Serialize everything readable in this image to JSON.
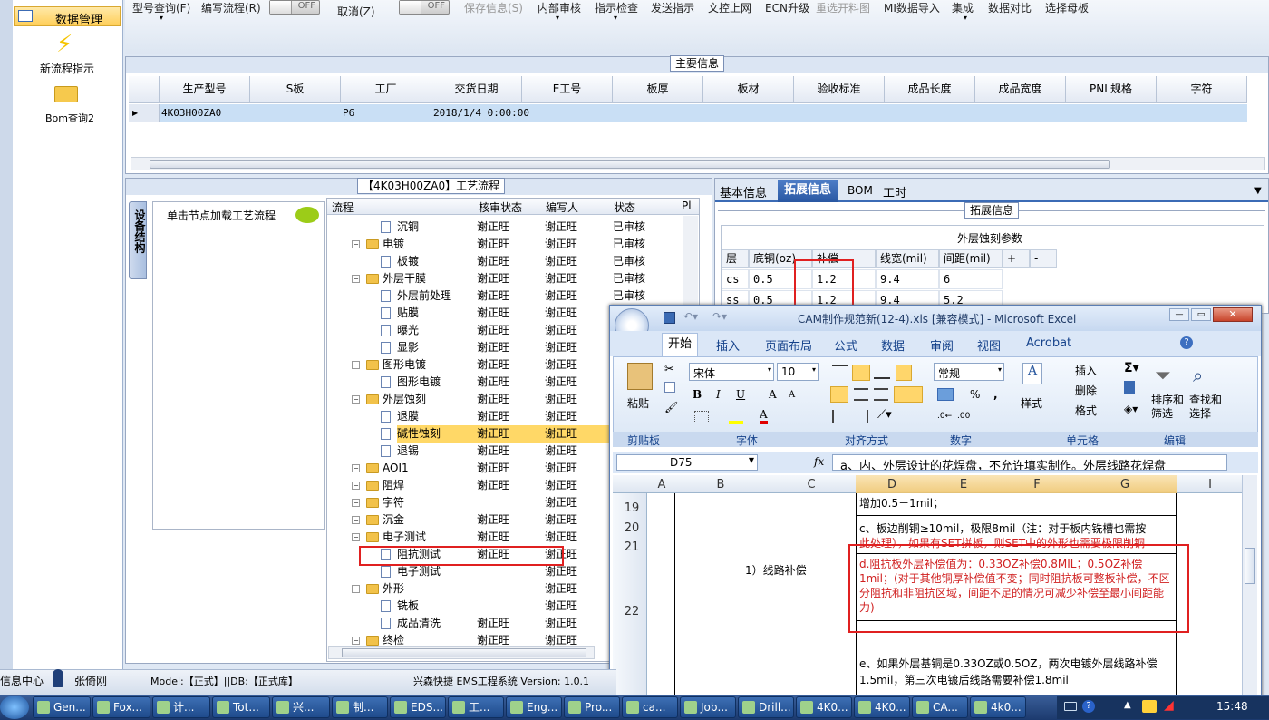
{
  "toolbar": {
    "items": [
      "型号查询(F)",
      "编写流程(R)",
      "取消(Z)",
      "保存信息(S)",
      "内部审核",
      "指示检查",
      "发送指示",
      "文控上网",
      "ECN升级",
      "重选开料图",
      "MI数据导入",
      "集成",
      "数据对比",
      "选择母板"
    ],
    "switch_off": "OFF"
  },
  "sidebar": {
    "header": "数据管理",
    "items": [
      {
        "label": "新流程指示",
        "icon": "lightning-icon"
      },
      {
        "label": "Bom查询2",
        "icon": "folder-open-icon"
      }
    ]
  },
  "main_info": {
    "title": "主要信息",
    "columns": [
      "生产型号",
      "S板",
      "工厂",
      "交货日期",
      "E工号",
      "板厚",
      "板材",
      "验收标准",
      "成品长度",
      "成品宽度",
      "PNL规格",
      "字符"
    ],
    "row": [
      "4K03H00ZA0",
      "",
      "P6",
      "2018/1/4 0:00:00",
      "",
      "",
      "",
      "",
      "",
      "",
      "",
      ""
    ]
  },
  "process": {
    "title": "【4K03H00ZA0】工艺流程",
    "side_tab": "设备结构",
    "hint": "单击节点加载工艺流程",
    "columns": [
      "流程",
      "核审状态",
      "编写人",
      "状态",
      "Pl"
    ],
    "rows": [
      {
        "name": "沉铜",
        "level": 2,
        "type": "doc",
        "review": "谢正旺",
        "writer": "谢正旺",
        "status": "已审核"
      },
      {
        "name": "电镀",
        "level": 1,
        "type": "folder",
        "review": "谢正旺",
        "writer": "谢正旺",
        "status": "已审核"
      },
      {
        "name": "板镀",
        "level": 2,
        "type": "doc",
        "review": "谢正旺",
        "writer": "谢正旺",
        "status": "已审核"
      },
      {
        "name": "外层干膜",
        "level": 1,
        "type": "folder",
        "review": "谢正旺",
        "writer": "谢正旺",
        "status": "已审核"
      },
      {
        "name": "外层前处理",
        "level": 2,
        "type": "doc",
        "review": "谢正旺",
        "writer": "谢正旺",
        "status": "已审核"
      },
      {
        "name": "贴膜",
        "level": 2,
        "type": "doc",
        "review": "谢正旺",
        "writer": "谢正旺",
        "status": "已审核"
      },
      {
        "name": "曝光",
        "level": 2,
        "type": "doc",
        "review": "谢正旺",
        "writer": "谢正旺",
        "status": "已审核"
      },
      {
        "name": "显影",
        "level": 2,
        "type": "doc",
        "review": "谢正旺",
        "writer": "谢正旺",
        "status": "已审核"
      },
      {
        "name": "图形电镀",
        "level": 1,
        "type": "folder",
        "review": "谢正旺",
        "writer": "谢正旺",
        "status": "已审核"
      },
      {
        "name": "图形电镀",
        "level": 2,
        "type": "doc",
        "review": "谢正旺",
        "writer": "谢正旺",
        "status": "已审核"
      },
      {
        "name": "外层蚀刻",
        "level": 1,
        "type": "folder",
        "review": "谢正旺",
        "writer": "谢正旺",
        "status": "已审核"
      },
      {
        "name": "退膜",
        "level": 2,
        "type": "doc",
        "review": "谢正旺",
        "writer": "谢正旺",
        "status": "已审核"
      },
      {
        "name": "碱性蚀刻",
        "level": 2,
        "type": "doc",
        "review": "谢正旺",
        "writer": "谢正旺",
        "status": "已审核",
        "selected": true
      },
      {
        "name": "退锡",
        "level": 2,
        "type": "doc",
        "review": "谢正旺",
        "writer": "谢正旺",
        "status": "已审核"
      },
      {
        "name": "AOI1",
        "level": 1,
        "type": "folder",
        "review": "谢正旺",
        "writer": "谢正旺",
        "status": ""
      },
      {
        "name": "阻焊",
        "level": 1,
        "type": "folder",
        "review": "谢正旺",
        "writer": "谢正旺",
        "status": ""
      },
      {
        "name": "字符",
        "level": 1,
        "type": "folder",
        "review": "",
        "writer": "谢正旺",
        "status": ""
      },
      {
        "name": "沉金",
        "level": 1,
        "type": "folder",
        "review": "谢正旺",
        "writer": "谢正旺",
        "status": ""
      },
      {
        "name": "电子测试",
        "level": 1,
        "type": "folder",
        "review": "谢正旺",
        "writer": "谢正旺",
        "status": ""
      },
      {
        "name": "阻抗测试",
        "level": 2,
        "type": "doc",
        "review": "谢正旺",
        "writer": "谢正旺",
        "status": "",
        "highlight": true
      },
      {
        "name": "电子测试",
        "level": 2,
        "type": "doc",
        "review": "",
        "writer": "谢正旺",
        "status": ""
      },
      {
        "name": "外形",
        "level": 1,
        "type": "folder",
        "review": "",
        "writer": "谢正旺",
        "status": ""
      },
      {
        "name": "铣板",
        "level": 2,
        "type": "doc",
        "review": "",
        "writer": "谢正旺",
        "status": ""
      },
      {
        "name": "成品清洗",
        "level": 2,
        "type": "doc",
        "review": "谢正旺",
        "writer": "谢正旺",
        "status": ""
      },
      {
        "name": "终检",
        "level": 1,
        "type": "folder",
        "review": "谢正旺",
        "writer": "谢正旺",
        "status": ""
      }
    ]
  },
  "right_tabs": [
    "基本信息",
    "拓展信息",
    "BOM",
    "工时"
  ],
  "ext": {
    "title": "拓展信息",
    "sub_title": "外层蚀刻参数",
    "columns": [
      "层",
      "底铜(oz)",
      "补偿",
      "线宽(mil)",
      "间距(mil)",
      "+",
      "-"
    ],
    "rows": [
      [
        "cs",
        "0.5",
        "1.2",
        "9.4",
        "6"
      ],
      [
        "ss",
        "0.5",
        "1.2",
        "9.4",
        "5.2"
      ]
    ]
  },
  "excel": {
    "title": "CAM制作规范新(12-4).xls  [兼容模式] - Microsoft Excel",
    "tabs": [
      "开始",
      "插入",
      "页面布局",
      "公式",
      "数据",
      "审阅",
      "视图",
      "Acrobat"
    ],
    "font_name": "宋体",
    "font_size": "10",
    "number_format": "常规",
    "paste": "粘贴",
    "style": "样式",
    "insert": "插入",
    "delete": "删除",
    "format": "格式",
    "sort": "排序和\n筛选",
    "find": "查找和\n选择",
    "groups": [
      "剪贴板",
      "字体",
      "对齐方式",
      "数字",
      "单元格",
      "编辑"
    ],
    "name_box": "D75",
    "formula": "a、内、外层设计的花焊盘，不允许填实制作。外层线路花焊盘",
    "col_headers": [
      "A",
      "B",
      "C",
      "D",
      "E",
      "F",
      "G",
      "I"
    ],
    "rows": [
      {
        "num": "19",
        "text": "增加0.5－1mil；"
      },
      {
        "num": "20",
        "text": "c、板边削铜≥10mil，极限8mil（注：对于板内铣槽也需按"
      },
      {
        "num": "21",
        "text": "此处理），如果有SET拼板，则SET中的外形也需要极限削铜"
      },
      {
        "num": "22",
        "text": "d.阻抗板外层补偿值为：0.33OZ补偿0.8MIL；0.5OZ补偿1mil；(对于其他铜厚补偿值不变；同时阻抗板可整板补偿，不区分阻抗和非阻抗区域，间距不足的情况可减少补偿至最小间距能力)"
      },
      {
        "num": "",
        "text": "e、如果外层基铜是0.33OZ或0.5OZ，两次电镀外层线路补偿1.5mil，第三次电镀后线路需要补偿1.8mil"
      }
    ],
    "c_label": "1）线路补偿"
  },
  "status": {
    "left": "信息中心",
    "user": "张倚刚",
    "model": "Model:【正式】||DB:【正式库】",
    "company": "兴森快捷 EMS工程系统 Version: 1.0.1"
  },
  "taskbar": {
    "buttons": [
      "Gen...",
      "Fox...",
      "计...",
      "Tot...",
      "兴...",
      "制...",
      "EDS...",
      "工...",
      "Eng...",
      "Pro...",
      "ca...",
      "Job...",
      "Drill...",
      "4K0...",
      "4K0...",
      "CA...",
      "4k0..."
    ],
    "clock": "15:48"
  }
}
